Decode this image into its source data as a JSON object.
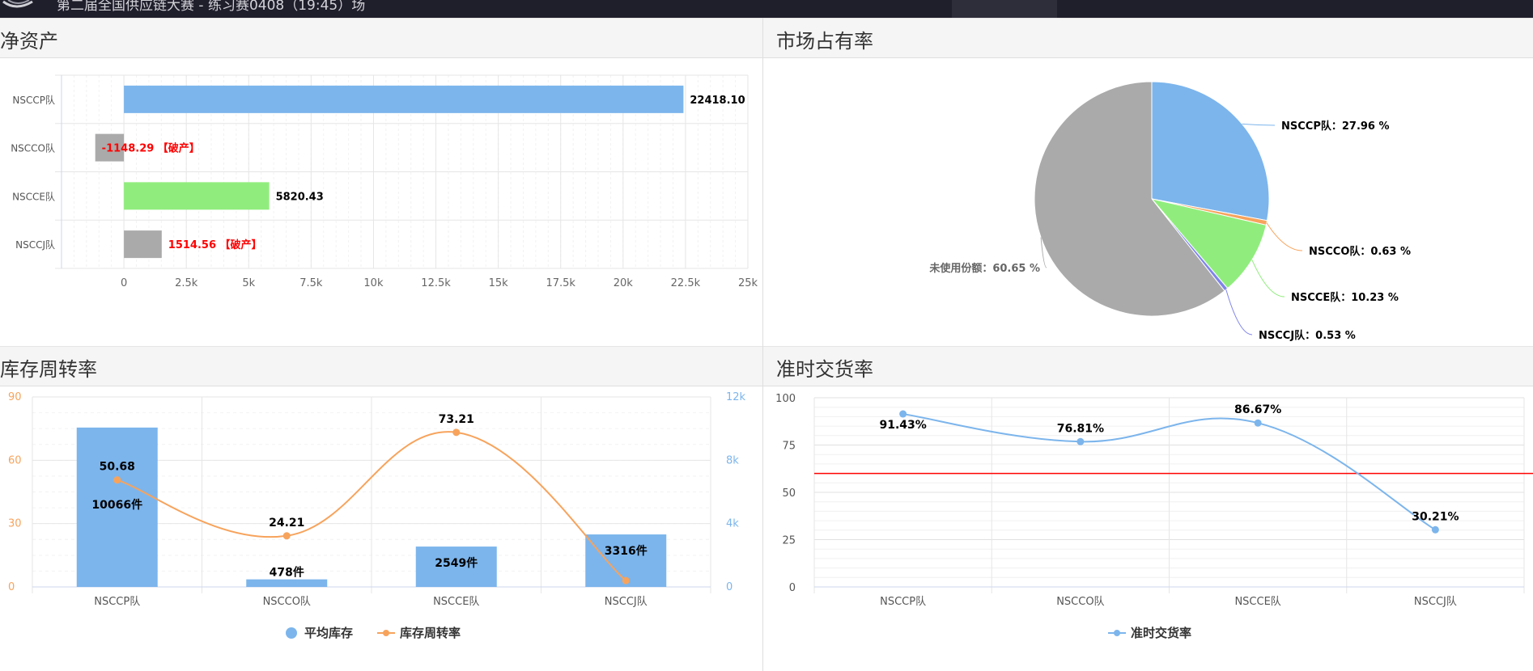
{
  "app": {
    "title": "第二届全国供应链大赛 - 练习赛0408（19:45）场"
  },
  "panels": {
    "net_assets": "净资产",
    "market_share": "市场占有率",
    "inventory_turnover": "库存周转率",
    "on_time_delivery": "准时交货率"
  },
  "chart_data": [
    {
      "type": "bar",
      "orientation": "horizontal",
      "title": "净资产",
      "categories": [
        "NSCCP队",
        "NSCCO队",
        "NSCCE队",
        "NSCCJ队"
      ],
      "values": [
        22418.1,
        -1148.29,
        5820.43,
        1514.56
      ],
      "labels": [
        "22418.10",
        "-1148.29 【破产】",
        "5820.43",
        "1514.56 【破产】"
      ],
      "bar_colors": [
        "#7cb5ec",
        "#aaaaaa",
        "#90ed7d",
        "#aaaaaa"
      ],
      "label_colors": [
        "#000000",
        "#ff0000",
        "#000000",
        "#ff0000"
      ],
      "xlim": [
        -2500,
        25000
      ],
      "xticks": [
        0,
        2500,
        5000,
        7500,
        10000,
        12500,
        15000,
        17500,
        20000,
        22500,
        25000
      ],
      "xtick_labels": [
        "0",
        "2.5k",
        "5k",
        "7.5k",
        "10k",
        "12.5k",
        "15k",
        "17.5k",
        "20k",
        "22.5k",
        "25k"
      ],
      "grid": true
    },
    {
      "type": "pie",
      "title": "市场占有率",
      "slices": [
        {
          "label": "NSCCP队",
          "value": 27.96,
          "display": "NSCCP队：27.96 %",
          "color": "#7cb5ec"
        },
        {
          "label": "NSCCO队",
          "value": 0.63,
          "display": "NSCCO队：0.63 %",
          "color": "#f7a35c"
        },
        {
          "label": "NSCCE队",
          "value": 10.23,
          "display": "NSCCE队：10.23 %",
          "color": "#90ed7d"
        },
        {
          "label": "NSCCJ队",
          "value": 0.53,
          "display": "NSCCJ队：0.53 %",
          "color": "#8085e9"
        },
        {
          "label": "未使用份额",
          "value": 60.65,
          "display": "未使用份额：60.65 %",
          "color": "#aaaaaa"
        }
      ]
    },
    {
      "type": "bar+line",
      "title": "库存周转率",
      "categories": [
        "NSCCP队",
        "NSCCO队",
        "NSCCE队",
        "NSCCJ队"
      ],
      "series": [
        {
          "name": "平均库存",
          "type": "bar",
          "axis": "right",
          "values": [
            10066,
            478,
            2549,
            3316
          ],
          "labels": [
            "10066件",
            "478件",
            "2549件",
            "3316件"
          ],
          "color": "#7cb5ec"
        },
        {
          "name": "库存周转率",
          "type": "line",
          "axis": "left",
          "values": [
            50.68,
            24.21,
            73.21,
            3.0
          ],
          "labels": [
            "50.68",
            "24.21",
            "73.21",
            ""
          ],
          "color": "#f7a35c"
        }
      ],
      "left_axis": {
        "ylim": [
          0,
          90
        ],
        "ticks": [
          "0",
          "30",
          "60",
          "90"
        ],
        "tick_values": [
          0,
          30,
          60,
          90
        ],
        "color": "#f7a35c"
      },
      "right_axis": {
        "ylim": [
          0,
          12000
        ],
        "ticks": [
          "0",
          "4k",
          "8k",
          "12k"
        ],
        "tick_values": [
          0,
          4000,
          8000,
          12000
        ],
        "color": "#7cb5ec"
      },
      "legend": "bottom-center",
      "grid": true
    },
    {
      "type": "line",
      "title": "准时交货率",
      "categories": [
        "NSCCP队",
        "NSCCO队",
        "NSCCE队",
        "NSCCJ队"
      ],
      "series": [
        {
          "name": "准时交货率",
          "values": [
            91.43,
            76.81,
            86.67,
            30.21
          ],
          "labels": [
            "91.43%",
            "76.81%",
            "86.67%",
            "30.21%"
          ],
          "color": "#7cb5ec"
        }
      ],
      "ylim": [
        0,
        100
      ],
      "yticks": [
        "0",
        "25",
        "50",
        "75",
        "100"
      ],
      "ytick_values": [
        0,
        25,
        50,
        75,
        100
      ],
      "reference_line": {
        "value": 60,
        "color": "#ff0000"
      },
      "legend": "bottom-center",
      "grid": true
    }
  ]
}
